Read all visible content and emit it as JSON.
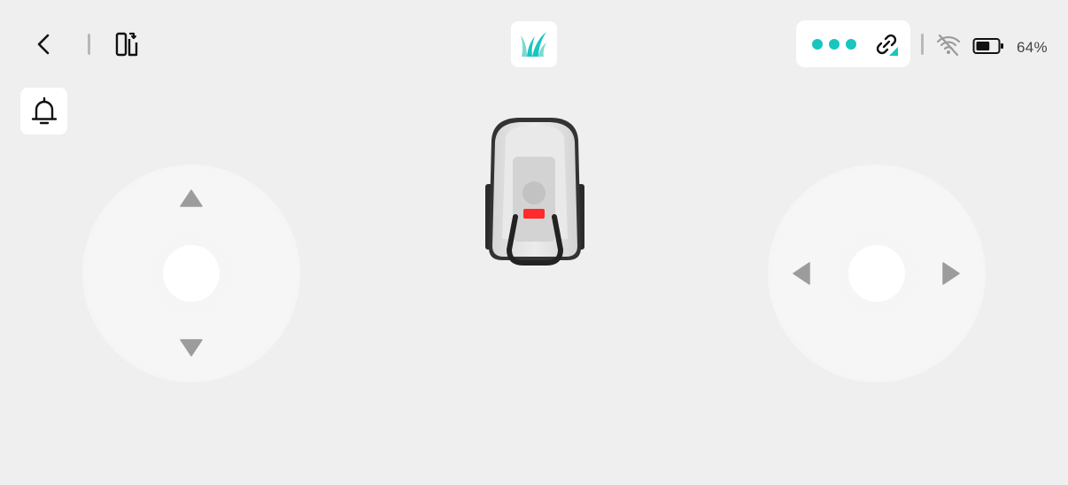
{
  "top_bar": {
    "back_icon": "chevron-left-icon",
    "switch_icon": "device-switch-icon",
    "app_logo_icon": "grass-icon",
    "connection": {
      "signal_dots": 3,
      "link_icon": "link-signal-icon",
      "accent_color": "#19c6bf"
    },
    "wifi_icon": "wifi-off-icon",
    "battery_icon": "battery-icon",
    "battery_level": 0.64,
    "battery_percent": "64%"
  },
  "notifications": {
    "bell_icon": "bell-icon"
  },
  "mower": {
    "indicator_color": "#ff2a2a"
  },
  "left_joystick": {
    "up_icon": "triangle-up-icon",
    "down_icon": "triangle-down-icon"
  },
  "right_joystick": {
    "left_icon": "triangle-left-icon",
    "right_icon": "triangle-right-icon"
  }
}
